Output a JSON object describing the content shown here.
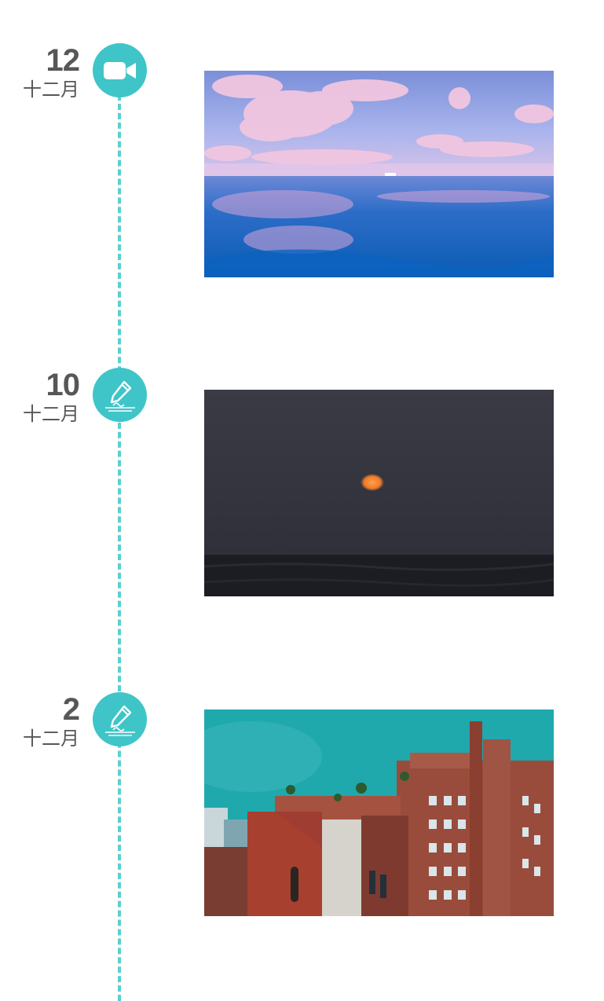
{
  "timeline": {
    "entries": [
      {
        "day": "12",
        "month": "十二月",
        "type_icon": "video-camera-icon",
        "photo": "ocean-pink-clouds"
      },
      {
        "day": "10",
        "month": "十二月",
        "type_icon": "pen-note-icon",
        "photo": "dusk-sea-orange-sun"
      },
      {
        "day": "2",
        "month": "十二月",
        "type_icon": "pen-note-icon",
        "photo": "brick-buildings-teal-sky"
      }
    ]
  },
  "colors": {
    "accent": "#3fc5c8",
    "timeline_line": "#5ccfcf",
    "date_text": "#575757",
    "background": "#ffffff"
  }
}
